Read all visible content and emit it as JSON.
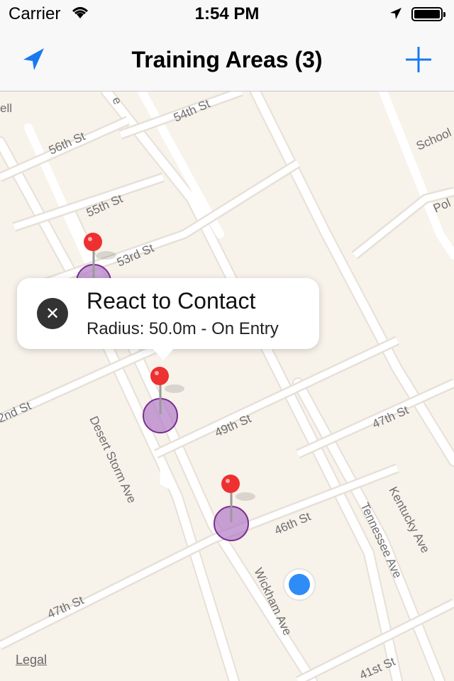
{
  "status_bar": {
    "carrier": "Carrier",
    "time": "1:54 PM",
    "wifi_icon": "wifi-icon",
    "location_icon": "location-arrow-icon",
    "battery_icon": "battery-icon"
  },
  "nav": {
    "title": "Training Areas (3)",
    "left_icon": "location-arrow-icon",
    "right_icon": "plus-icon",
    "accent_color": "#1a78f0"
  },
  "callout": {
    "title": "React to Contact",
    "subtitle": "Radius: 50.0m - On Entry",
    "close_icon": "close-icon"
  },
  "map": {
    "streets": [
      "56th St",
      "54th St",
      "55th St",
      "53rd St",
      "49th St",
      "47th St",
      "46th St",
      "47th St",
      "41st St",
      "2nd St",
      "Desert Storm Ave",
      "Tennessee Ave",
      "Kentucky Ave",
      "Wickham Ave",
      "School",
      "Pol",
      "ell",
      "e"
    ],
    "pin_color": "#ee3030",
    "region_color": "#b07bc6",
    "user_location_color": "#2f8cf6",
    "legal": "Legal"
  }
}
